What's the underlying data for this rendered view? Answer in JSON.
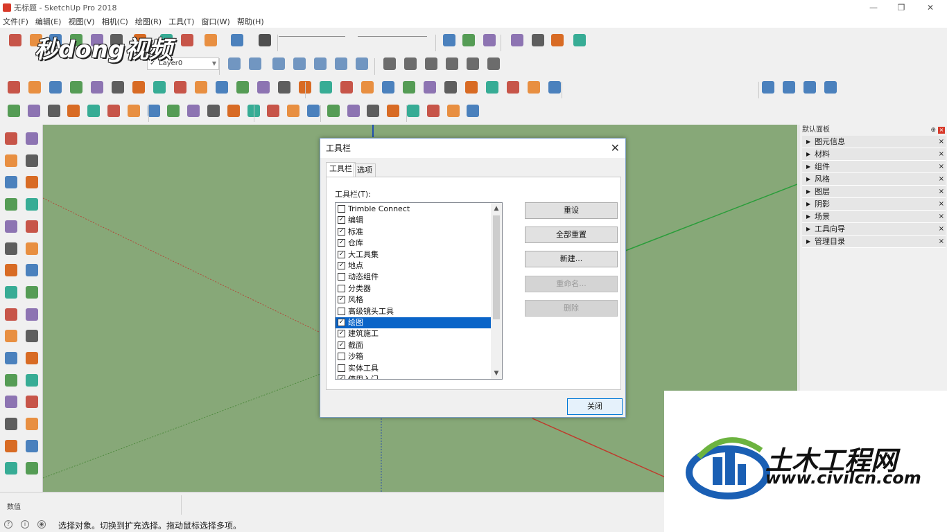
{
  "window": {
    "title": "无标题 - SketchUp Pro 2018",
    "minimize": "—",
    "restore": "❐",
    "close": "✕"
  },
  "menu": [
    "文件(F)",
    "编辑(E)",
    "视图(V)",
    "相机(C)",
    "绘图(R)",
    "工具(T)",
    "窗口(W)",
    "帮助(H)"
  ],
  "layer_select": {
    "value": "Layer0",
    "check": "✓",
    "arrow": "▼"
  },
  "panel": {
    "title": "默认面板",
    "pin": "⊕",
    "close": "×",
    "items": [
      {
        "label": "图元信息"
      },
      {
        "label": "材料"
      },
      {
        "label": "组件"
      },
      {
        "label": "风格"
      },
      {
        "label": "图层"
      },
      {
        "label": "阴影"
      },
      {
        "label": "场景"
      },
      {
        "label": "工具向导"
      },
      {
        "label": "管理目录"
      }
    ],
    "expand_glyph": "▶",
    "item_close": "×"
  },
  "measurements": {
    "label": "数值",
    "value": ""
  },
  "status": {
    "message": "选择对象。切换到扩充选择。拖动鼠标选择多项。",
    "icons": [
      "?",
      "i",
      "◉"
    ]
  },
  "dialog": {
    "title": "工具栏",
    "close": "✕",
    "tabs": [
      {
        "label": "工具栏",
        "active": true
      },
      {
        "label": "选项",
        "active": false
      }
    ],
    "list_label": "工具栏(T):",
    "list": [
      {
        "label": "Trimble Connect",
        "checked": false
      },
      {
        "label": "编辑",
        "checked": true
      },
      {
        "label": "标准",
        "checked": true
      },
      {
        "label": "仓库",
        "checked": true
      },
      {
        "label": "大工具集",
        "checked": true
      },
      {
        "label": "地点",
        "checked": true
      },
      {
        "label": "动态组件",
        "checked": false
      },
      {
        "label": "分类器",
        "checked": false
      },
      {
        "label": "风格",
        "checked": true
      },
      {
        "label": "高级镜头工具",
        "checked": false
      },
      {
        "label": "绘图",
        "checked": true,
        "selected": true
      },
      {
        "label": "建筑施工",
        "checked": true
      },
      {
        "label": "截面",
        "checked": true
      },
      {
        "label": "沙箱",
        "checked": false
      },
      {
        "label": "实体工具",
        "checked": false
      },
      {
        "label": "使用入门",
        "checked": true
      }
    ],
    "buttons": [
      {
        "label": "重设",
        "enabled": true
      },
      {
        "label": "全部重置",
        "enabled": true
      },
      {
        "label": "新建...",
        "enabled": true
      },
      {
        "label": "重命名...",
        "enabled": false
      },
      {
        "label": "删除",
        "enabled": false
      }
    ],
    "close_button": "关闭",
    "check_glyph": "✓",
    "scroll_up": "▲",
    "scroll_down": "▼"
  },
  "watermarks": {
    "top_left": "秒dong视频",
    "bottom_right_cn": "土木工程网",
    "bottom_right_url": "www.civilcn.com"
  },
  "colors": {
    "viewport": "#87a878",
    "selection": "#0a64c8",
    "axis_red": "#c0392b",
    "axis_green": "#2a9d3a",
    "axis_blue": "#1f4fb0",
    "brand_blue": "#1a5fb4",
    "brand_green": "#6cb33f"
  }
}
